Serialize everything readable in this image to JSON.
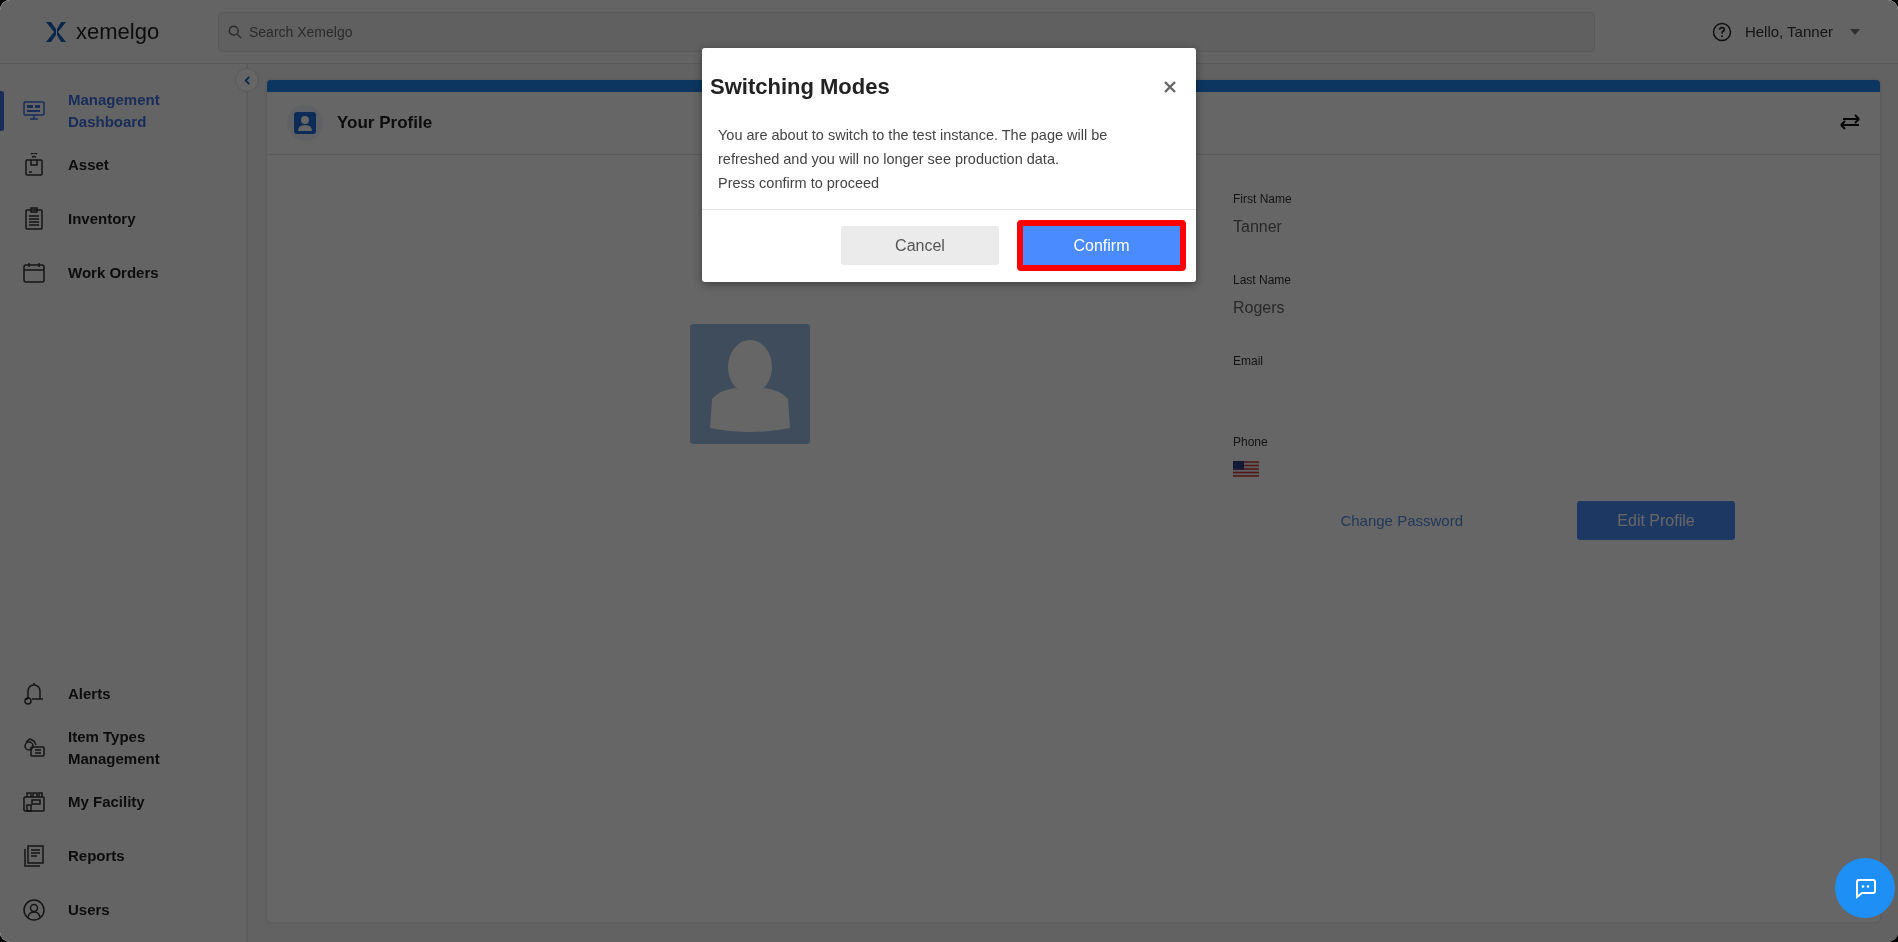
{
  "header": {
    "logo": "xemelgo",
    "search": {
      "placeholder": "Search Xemelgo"
    },
    "user_menu": "Hello, Tanner"
  },
  "sidebar": {
    "main_items": [
      {
        "label": "Management Dashboard",
        "selected": true
      },
      {
        "label": "Asset",
        "selected": false
      },
      {
        "label": "Inventory",
        "selected": false
      },
      {
        "label": "Work Orders",
        "selected": false
      }
    ],
    "bottom_items": [
      {
        "label": "Alerts",
        "selected": false
      },
      {
        "label": "Item Types Management",
        "selected": false
      },
      {
        "label": "My Facility",
        "selected": false
      },
      {
        "label": "Reports",
        "selected": false
      },
      {
        "label": "Users",
        "selected": false
      }
    ]
  },
  "profile": {
    "title": "Your Profile",
    "fields": [
      {
        "kind": "text",
        "label": "First Name",
        "value": "Tanner"
      },
      {
        "kind": "text",
        "label": "Last Name",
        "value": "Rogers"
      },
      {
        "kind": "text",
        "label": "Email"
      },
      {
        "kind": "phone",
        "label": "Phone"
      }
    ],
    "change_password": "Change Password",
    "edit_button": "Edit Profile"
  },
  "modal": {
    "title": "Switching Modes",
    "message": [
      "You are about to switch to the test instance. The page will be refreshed and you will no longer see production data.",
      "Press confirm to proceed"
    ],
    "buttons": [
      {
        "label": "Cancel",
        "kind": "secondary",
        "highlighted": false
      },
      {
        "label": "Confirm",
        "kind": "primary",
        "highlighted": true
      }
    ]
  }
}
